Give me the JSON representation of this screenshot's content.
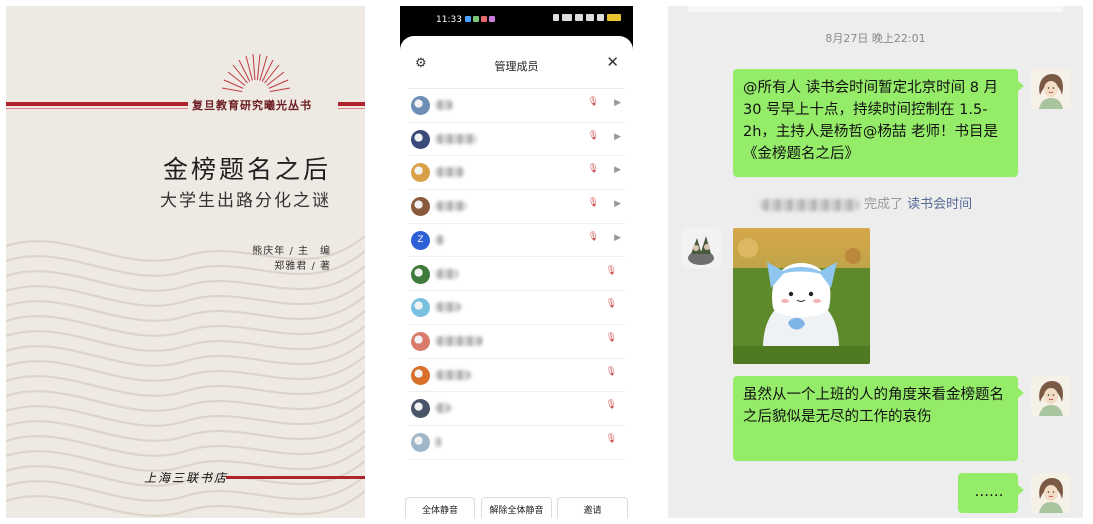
{
  "book": {
    "series": "复旦教育研究曦光丛书",
    "title": "金榜题名之后",
    "subtitle": "大学生出路分化之谜",
    "author_editor": "熊庆年 / 主　编",
    "author_writer": "郑雅君 / 著",
    "publisher": "上海三联书店"
  },
  "phone": {
    "status_time": "11:33",
    "title": "管理成员",
    "members": [
      {
        "icon": "avatar-1"
      },
      {
        "icon": "avatar-2"
      },
      {
        "icon": "avatar-3"
      },
      {
        "icon": "avatar-4"
      },
      {
        "letter": "Z"
      },
      {
        "icon": "avatar-6"
      },
      {
        "icon": "avatar-7"
      },
      {
        "icon": "avatar-8"
      },
      {
        "icon": "avatar-9"
      },
      {
        "icon": "avatar-10"
      },
      {
        "icon": "avatar-11"
      }
    ],
    "buttons": {
      "mute_all": "全体静音",
      "unmute_all": "解除全体静音",
      "invite": "邀请"
    }
  },
  "chat": {
    "timestamp": "8月27日 晚上22:01",
    "msg1": "@所有人  读书会时间暂定北京时间 8 月 30 号早上十点，持续时间控制在 1.5-2h，主持人是杨哲@杨喆  老师！书目是《金榜题名之后》",
    "system_done": "完成了",
    "system_link": "读书会时间",
    "msg2": "虽然从一个上班的人的角度来看金榜题名之后貌似是无尽的工作的哀伤",
    "msg3": "……"
  },
  "colors": {
    "wechat_green": "#95ec69",
    "book_red": "#b0222c",
    "link_blue": "#576b95"
  }
}
